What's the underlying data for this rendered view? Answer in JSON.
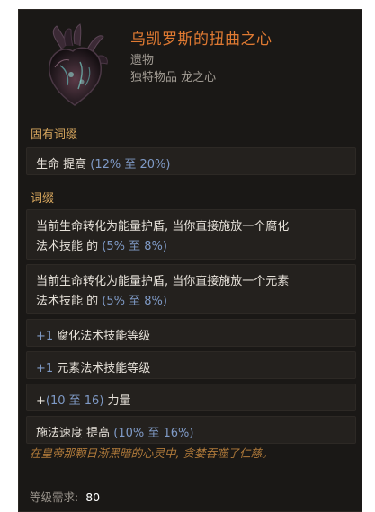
{
  "item": {
    "name": "乌凯罗斯的扭曲之心",
    "class": "遗物",
    "type_line": "独特物品 龙之心",
    "icon": "twisted-heart-icon"
  },
  "implicit": {
    "title": "固有词缀",
    "mods": [
      {
        "prefix": "生命 提高 ",
        "range": "(12% 至 20%)",
        "suffix": ""
      }
    ]
  },
  "affix": {
    "title": "词缀",
    "mods": [
      {
        "line1": "当前生命转化为能量护盾, 当你直接施放一个腐化",
        "line2_prefix": "法术技能 的 ",
        "line2_range": "(5% 至 8%)"
      },
      {
        "line1": "当前生命转化为能量护盾, 当你直接施放一个元素",
        "line2_prefix": "法术技能 的 ",
        "line2_range": "(5% 至 8%)"
      },
      {
        "num": "+1",
        "text": " 腐化法术技能等级"
      },
      {
        "num": "+1",
        "text": " 元素法术技能等级"
      },
      {
        "plus": "+",
        "range": "(10 至 16)",
        "text": " 力量"
      },
      {
        "prefix": "施法速度 提高 ",
        "range": "(10% 至 16%)"
      }
    ]
  },
  "flavour_text": "在皇帝那颗日渐黑暗的心灵中, 贪婪吞噬了仁慈。",
  "requirement": {
    "label": "等级需求:",
    "value": "80"
  },
  "colors": {
    "background": "#1a1816",
    "mod_box": "#24211e",
    "unique_name": "#e07a32",
    "section_title": "#d8a75e",
    "number_blue": "#7f9ac6",
    "flavour": "#b07a3a"
  }
}
